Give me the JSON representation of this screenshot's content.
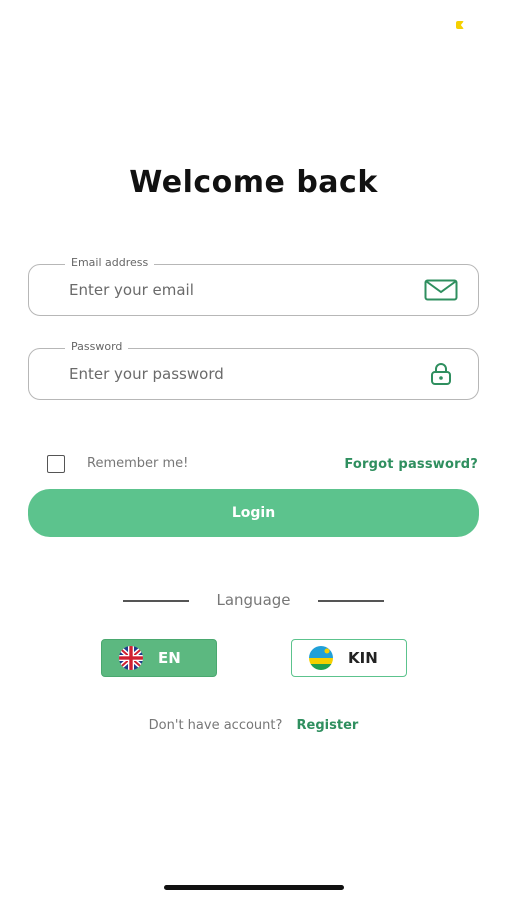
{
  "colors": {
    "accent": "#5cc38d",
    "link": "#2f8f5f",
    "status_dot": "#f5d000"
  },
  "title": "Welcome back",
  "email": {
    "label": "Email address",
    "placeholder": "Enter your email",
    "value": "",
    "icon": "mail-icon"
  },
  "password": {
    "label": "Password",
    "placeholder": "Enter your password",
    "value": "",
    "icon": "lock-icon"
  },
  "remember": {
    "label": "Remember me!",
    "checked": false
  },
  "forgot_label": "Forgot password?",
  "login_label": "Login",
  "language": {
    "heading": "Language",
    "options": [
      {
        "code": "EN",
        "flag": "uk-flag-icon",
        "selected": true
      },
      {
        "code": "KIN",
        "flag": "rwanda-flag-icon",
        "selected": false
      }
    ]
  },
  "register": {
    "prompt": "Don't have account?",
    "link_label": "Register"
  }
}
